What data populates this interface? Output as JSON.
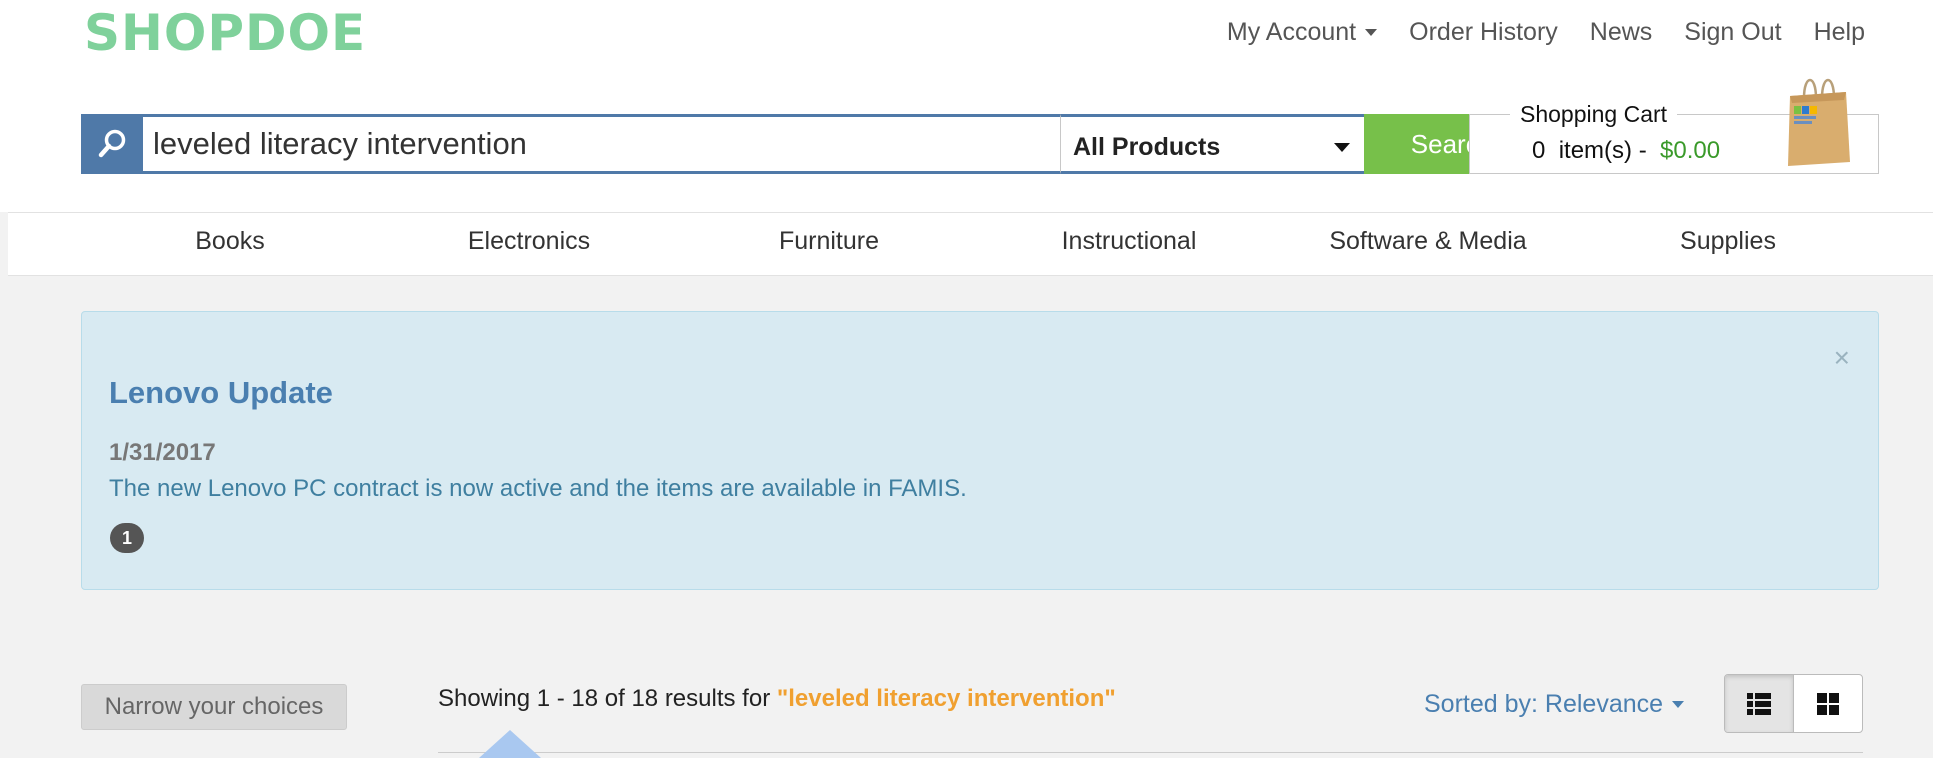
{
  "logo": "SHOPDOE",
  "top_nav": [
    {
      "label": "My Account",
      "dropdown": true
    },
    {
      "label": "Order History",
      "dropdown": false
    },
    {
      "label": "News",
      "dropdown": false
    },
    {
      "label": "Sign Out",
      "dropdown": false
    },
    {
      "label": "Help",
      "dropdown": false
    }
  ],
  "search": {
    "value": "leveled literacy intervention",
    "category_selected": "All Products",
    "button_label": "Search"
  },
  "cart": {
    "title": "Shopping Cart",
    "count": "0",
    "items_label": "item(s) -",
    "total": "$0.00"
  },
  "categories": [
    "Books",
    "Electronics",
    "Furniture",
    "Instructional",
    "Software & Media",
    "Supplies"
  ],
  "alert": {
    "title": "Lenovo Update",
    "date": "1/31/2017",
    "body": "The new Lenovo PC contract is now active and the items are available in FAMIS.",
    "badge": "1",
    "close": "×"
  },
  "results": {
    "narrow_label": "Narrow your choices",
    "showing": "Showing 1 - 18 of 18 results for ",
    "query": "\"leveled literacy intervention\"",
    "sort_label": "Sorted by: Relevance"
  },
  "colors": {
    "logo": "#7fd19b",
    "search_border": "#4f79a8",
    "search_button": "#77c04a",
    "cart_total": "#3a9a2a",
    "alert_bg": "#d8eaf2",
    "alert_title": "#4a7fb0",
    "query_highlight": "#f0a030"
  }
}
